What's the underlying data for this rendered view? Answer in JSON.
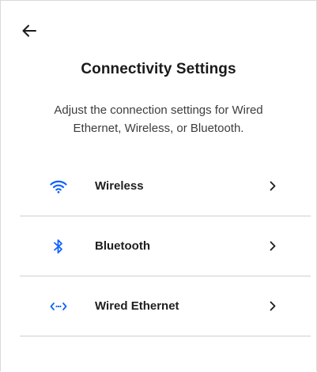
{
  "header": {
    "back_icon": "arrow-left-icon",
    "title": "Connectivity Settings",
    "subtitle": "Adjust the connection settings for Wired Ethernet, Wireless, or Bluetooth."
  },
  "options": [
    {
      "label": "Wireless",
      "icon": "wifi-icon"
    },
    {
      "label": "Bluetooth",
      "icon": "bluetooth-icon"
    },
    {
      "label": "Wired Ethernet",
      "icon": "ethernet-icon"
    }
  ],
  "colors": {
    "accent": "#0f62fe",
    "text": "#1a1a1a",
    "divider": "#cfcfcf"
  }
}
